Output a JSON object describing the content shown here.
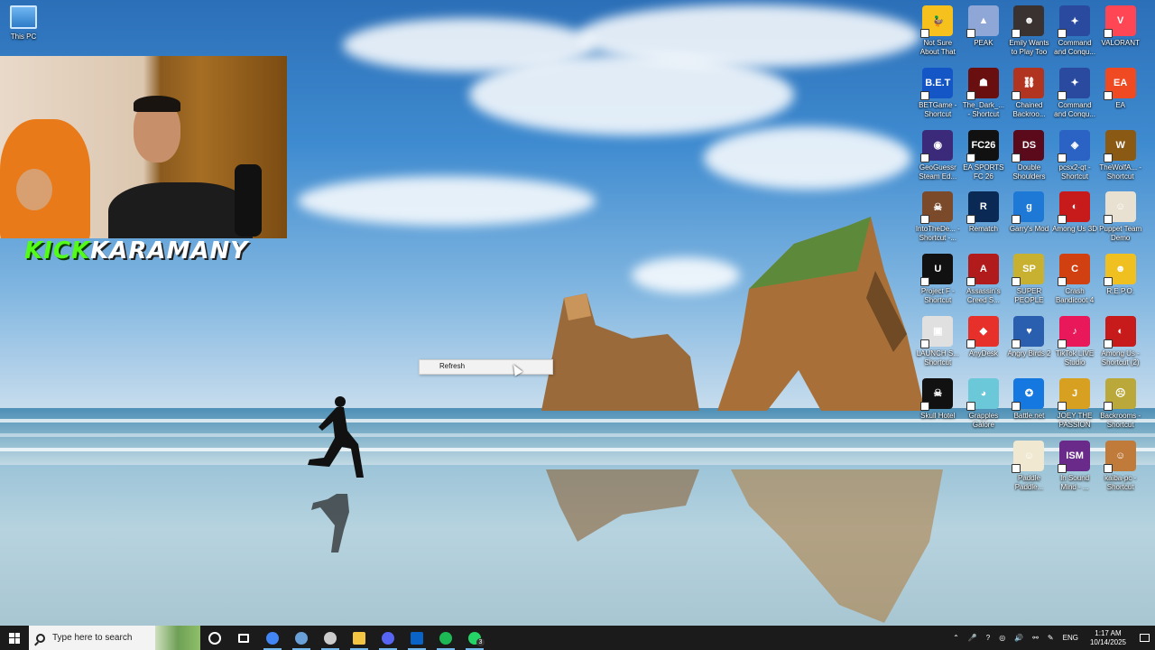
{
  "desktop": {
    "this_pc_label": "This PC",
    "icons": [
      {
        "label": "Not Sure About That",
        "color": "#f6c11c",
        "glyph": "🦆"
      },
      {
        "label": "PEAK",
        "color": "#8fa7d6",
        "glyph": "▲"
      },
      {
        "label": "Emily Wants to Play Too",
        "color": "#3a3230",
        "glyph": "☻"
      },
      {
        "label": "Command and Conqu...",
        "color": "#2a4aa0",
        "glyph": "✦"
      },
      {
        "label": "VALORANT",
        "color": "#ff4655",
        "glyph": "V"
      },
      {
        "label": "BETGame - Shortcut",
        "color": "#1556c7",
        "glyph": "B.E.T"
      },
      {
        "label": "The_Dark_... - Shortcut",
        "color": "#6a0f0f",
        "glyph": "☗"
      },
      {
        "label": "Chained Backroo...",
        "color": "#b0341f",
        "glyph": "⛓"
      },
      {
        "label": "Command and Conqu...",
        "color": "#2a4aa0",
        "glyph": "✦"
      },
      {
        "label": "EA",
        "color": "#f04a22",
        "glyph": "EA"
      },
      {
        "label": "GeoGuessr Steam Ed...",
        "color": "#3b2a7a",
        "glyph": "◉"
      },
      {
        "label": "EA SPORTS FC 26",
        "color": "#111111",
        "glyph": "FC26"
      },
      {
        "label": "Double Shoulders",
        "color": "#5a0a1a",
        "glyph": "DS"
      },
      {
        "label": "pcsx2-qt - Shortcut",
        "color": "#2b63c4",
        "glyph": "◈"
      },
      {
        "label": "TheWolfA... - Shortcut",
        "color": "#8a5a14",
        "glyph": "W"
      },
      {
        "label": "IntoTheDe... - Shortcut -...",
        "color": "#7a4a2a",
        "glyph": "☠"
      },
      {
        "label": "Rematch",
        "color": "#0a2a55",
        "glyph": "R"
      },
      {
        "label": "Garry's Mod",
        "color": "#1e78d6",
        "glyph": "g"
      },
      {
        "label": "Among Us 3D",
        "color": "#c71a1a",
        "glyph": "◐"
      },
      {
        "label": "Puppet Team Demo",
        "color": "#e8e0d0",
        "glyph": "☺"
      },
      {
        "label": "Project F - Shortcut",
        "color": "#111111",
        "glyph": "U"
      },
      {
        "label": "Assassin's Creed S...",
        "color": "#b21b1b",
        "glyph": "A"
      },
      {
        "label": "SUPER PEOPLE",
        "color": "#c8b030",
        "glyph": "SP"
      },
      {
        "label": "Crash Bandicoot 4",
        "color": "#d04010",
        "glyph": "C"
      },
      {
        "label": "R.E.P.O.",
        "color": "#f0c020",
        "glyph": "☻"
      },
      {
        "label": "LAUNCH S... Shortcut",
        "color": "#e0e0e0",
        "glyph": "▣"
      },
      {
        "label": "AnyDesk",
        "color": "#e8302a",
        "glyph": "◆"
      },
      {
        "label": "Angry Birds 2",
        "color": "#2a5fb0",
        "glyph": "♥"
      },
      {
        "label": "TikTok LIVE Studio",
        "color": "#e8185a",
        "glyph": "♪"
      },
      {
        "label": "Among Us - Shortcut (2)",
        "color": "#c71a1a",
        "glyph": "◐"
      },
      {
        "label": "Skull Hotel",
        "color": "#111111",
        "glyph": "☠"
      },
      {
        "label": "Grapples Galore",
        "color": "#6ac8d8",
        "glyph": "◕"
      },
      {
        "label": "Battle.net",
        "color": "#1577e0",
        "glyph": "✪"
      },
      {
        "label": "JOEY THE PASSION",
        "color": "#d8a020",
        "glyph": "J"
      },
      {
        "label": "Backrooms - Shortcut",
        "color": "#bba83a",
        "glyph": "☹"
      },
      {
        "label": "",
        "color": "",
        "glyph": ""
      },
      {
        "label": "",
        "color": "",
        "glyph": ""
      },
      {
        "label": "Paddle Paddle...",
        "color": "#f0e8d0",
        "glyph": "☺"
      },
      {
        "label": "In Sound Mind - ...",
        "color": "#6a2a8a",
        "glyph": "ISM"
      },
      {
        "label": "kaiba-pc - Shortcut",
        "color": "#c07a3a",
        "glyph": "☺"
      }
    ]
  },
  "overlay": {
    "brand_kick": "KICK",
    "brand_name": "KARAMANY"
  },
  "context_menu": {
    "items": [
      {
        "label": "Refresh"
      }
    ]
  },
  "taskbar": {
    "search_placeholder": "Type here to search",
    "apps": [
      {
        "name": "cortana",
        "color": "#ffffff"
      },
      {
        "name": "task-view",
        "color": "#ffffff"
      },
      {
        "name": "chrome",
        "color": "#4285f4"
      },
      {
        "name": "steam",
        "color": "#6aa0d8"
      },
      {
        "name": "obs",
        "color": "#cccccc"
      },
      {
        "name": "file-explorer",
        "color": "#f4c542"
      },
      {
        "name": "discord",
        "color": "#5865f2"
      },
      {
        "name": "outlook",
        "color": "#0a64c8"
      },
      {
        "name": "spotify",
        "color": "#1db954"
      },
      {
        "name": "whatsapp",
        "color": "#25d366"
      }
    ],
    "whatsapp_badge": "3",
    "tray": {
      "language": "ENG",
      "time": "1:17 AM",
      "date": "10/14/2025"
    }
  },
  "colors": {
    "taskbar": "#1b1b1b",
    "kick_green": "#53fc18"
  }
}
